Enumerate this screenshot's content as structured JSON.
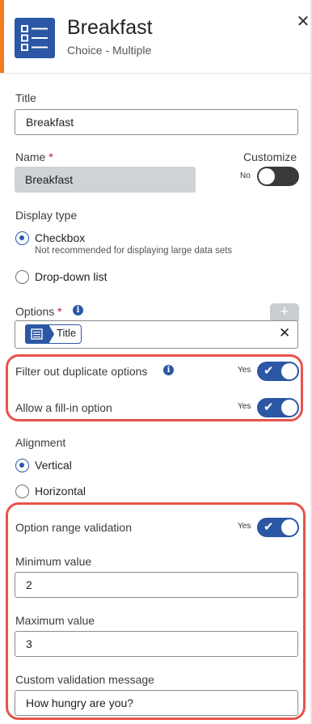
{
  "header": {
    "title": "Breakfast",
    "subtitle": "Choice - Multiple",
    "close_icon": "close-icon",
    "app_icon": "checklist-icon",
    "accent_color": "#f47b20",
    "icon_color": "#2b57a4"
  },
  "title_field": {
    "label": "Title",
    "value": "Breakfast"
  },
  "name_field": {
    "label": "Name",
    "required_mark": "*",
    "value": "Breakfast",
    "customize_label": "Customize",
    "customize_state": "No",
    "customize_on": false
  },
  "display_type": {
    "label": "Display type",
    "options": [
      {
        "label": "Checkbox",
        "note": "Not recommended for displaying large data sets",
        "selected": true
      },
      {
        "label": "Drop-down list",
        "note": "",
        "selected": false
      }
    ]
  },
  "options_field": {
    "label": "Options",
    "required_mark": "*",
    "chip_label": "Title",
    "add_label": "+",
    "remove_label": "✕"
  },
  "toggles_group1": [
    {
      "label": "Filter out duplicate options",
      "state": "Yes",
      "on": true,
      "has_info": true
    },
    {
      "label": "Allow a fill-in option",
      "state": "Yes",
      "on": true,
      "has_info": false
    }
  ],
  "alignment": {
    "label": "Alignment",
    "options": [
      {
        "label": "Vertical",
        "selected": true
      },
      {
        "label": "Horizontal",
        "selected": false
      }
    ]
  },
  "validation": {
    "label": "Option range validation",
    "state": "Yes",
    "on": true,
    "min_label": "Minimum value",
    "min_value": "2",
    "max_label": "Maximum value",
    "max_value": "3",
    "message_label": "Custom validation message",
    "message_value": "How hungry are you?"
  },
  "colors": {
    "highlight": "#e8534a",
    "primary": "#2b57a4"
  }
}
